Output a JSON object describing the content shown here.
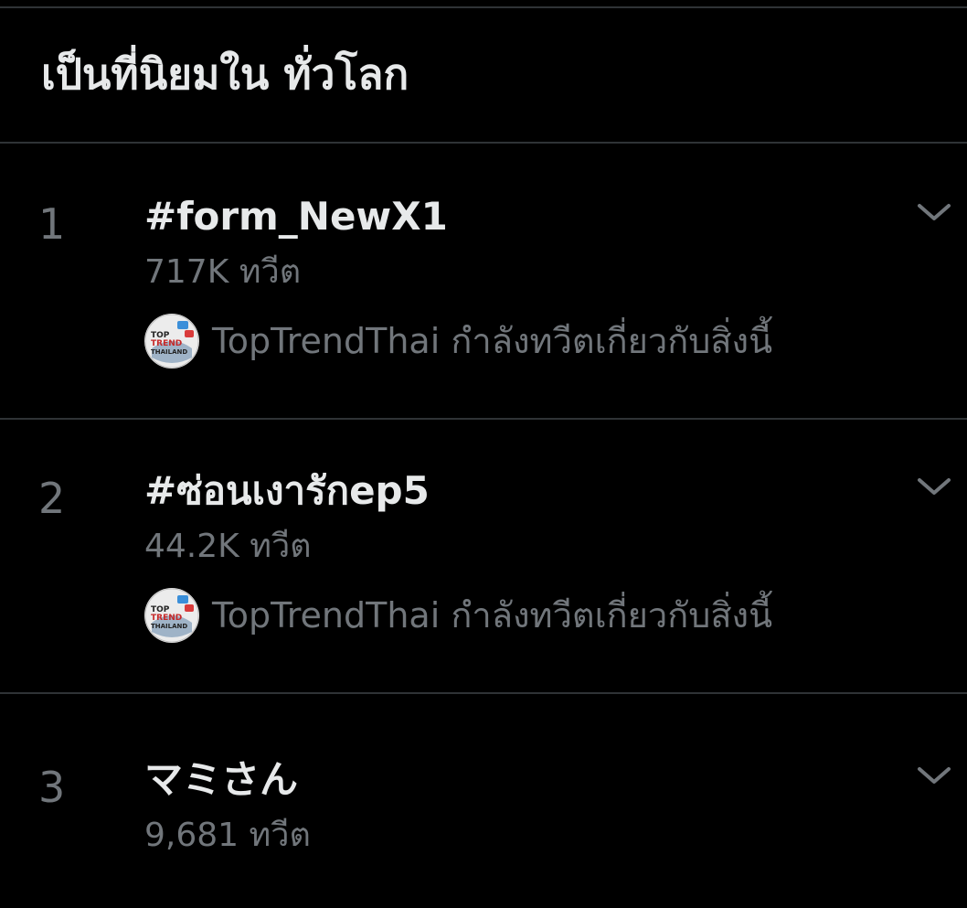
{
  "header": {
    "title": "เป็นที่นิยมใน ทั่วโลก"
  },
  "trends": [
    {
      "rank": "1",
      "name": "#form_NewX1",
      "count": "717K ทวีต",
      "context": {
        "account": "TopTrendThai",
        "text": "TopTrendThai กำลังทวีตเกี่ยวกับสิ่งนี้",
        "avatar_text": "TOP TREND THAILAND"
      }
    },
    {
      "rank": "2",
      "name": "#ซ่อนเงารักep5",
      "count": "44.2K ทวีต",
      "context": {
        "account": "TopTrendThai",
        "text": "TopTrendThai กำลังทวีตเกี่ยวกับสิ่งนี้",
        "avatar_text": "TOP TREND THAILAND"
      }
    },
    {
      "rank": "3",
      "name": "マミさん",
      "count": "9,681 ทวีต"
    }
  ],
  "icons": {
    "more": "chevron-down-icon",
    "avatar": "toptrendthai-avatar"
  },
  "colors": {
    "background": "#000000",
    "primary_text": "#e7e9ea",
    "secondary_text": "#71767b",
    "divider": "#2f3336"
  }
}
